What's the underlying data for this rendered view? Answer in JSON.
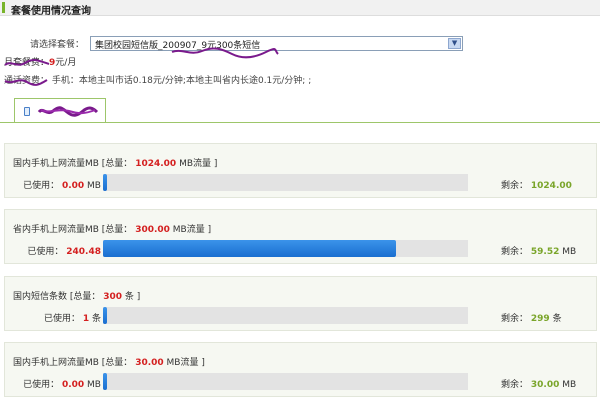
{
  "header": {
    "title": "套餐使用情况查询"
  },
  "plan": {
    "label": "请选择套餐：",
    "selected": "集团校园短信版_200907_9元300条短信"
  },
  "fee": {
    "label": "月套餐费：",
    "amount": "9",
    "unit": "元/月"
  },
  "voice": {
    "text": "通话资费： 手机：本地主叫市话0.18元/分钟;本地主叫省内长途0.1元/分钟; ;"
  },
  "tab": {
    "icon": "phone-icon"
  },
  "colors": {
    "accent_green": "#9dc66a",
    "red": "#d42020",
    "remain_green": "#7aa52a",
    "bar_blue": "#1a6fd0"
  },
  "panels": [
    {
      "title_prefix": "国内手机上网流量MB [总量：",
      "total": "1024.00",
      "title_suffix": "MB流量 ]",
      "used_label": "已使用：",
      "used_value": "0.00",
      "used_unit": "MB",
      "remain_label": "剩余：",
      "remain_value": "1024.00",
      "remain_unit": "",
      "fraction": 0.0
    },
    {
      "title_prefix": "省内手机上网流量MB [总量：",
      "total": "300.00",
      "title_suffix": "MB流量 ]",
      "used_label": "已使用：",
      "used_value": "240.48",
      "used_unit": "",
      "remain_label": "剩余：",
      "remain_value": "59.52",
      "remain_unit": "MB",
      "fraction": 0.8016
    },
    {
      "title_prefix": "国内短信条数 [总量：",
      "total": "300",
      "title_suffix": "条 ]",
      "used_label": "已使用：",
      "used_value": "1",
      "used_unit": "条",
      "remain_label": "剩余：",
      "remain_value": "299",
      "remain_unit": "条",
      "fraction": 0.0033
    },
    {
      "title_prefix": "国内手机上网流量MB [总量：",
      "total": "30.00",
      "title_suffix": "MB流量 ]",
      "used_label": "已使用：",
      "used_value": "0.00",
      "used_unit": "MB",
      "remain_label": "剩余：",
      "remain_value": "30.00",
      "remain_unit": "MB",
      "fraction": 0.0
    }
  ]
}
